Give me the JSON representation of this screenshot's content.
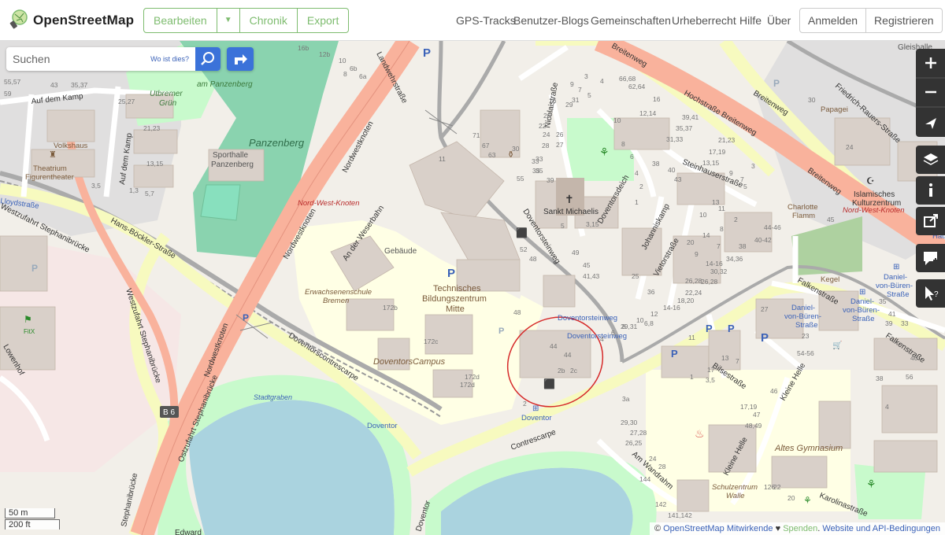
{
  "header": {
    "brand": "OpenStreetMap",
    "edit_label": "Bearbeiten",
    "history_label": "Chronik",
    "export_label": "Export",
    "nav": [
      "GPS-Tracks",
      "Benutzer-Blogs",
      "Gemeinschaften",
      "Urheberrecht",
      "Hilfe",
      "Über"
    ],
    "login_label": "Anmelden",
    "signup_label": "Registrieren"
  },
  "search": {
    "placeholder": "Suchen",
    "where_label": "Wo ist dies?"
  },
  "map_controls": [
    "zoom-in",
    "zoom-out",
    "locate",
    "layers",
    "info",
    "share",
    "note",
    "query"
  ],
  "scale": {
    "metric": "50 m",
    "imperial": "200 ft"
  },
  "attribution": {
    "prefix": "©",
    "contributors": "OpenStreetMap Mitwirkende",
    "heart": "♥",
    "donate": "Spenden",
    "terms": "Website und API-Bedingungen"
  },
  "map_labels": {
    "panzenberg": "Panzenberg",
    "am_panzenberg": "am Panzenberg",
    "utbremer": "Utbremer",
    "gruen": "Grün",
    "sporthalle": "Sporthalle",
    "sporthalle2": "Panzenberg",
    "auf_dem_kamp": "Auf dem Kamp",
    "auf_dem_kamp_v": "Auf dem Kamp",
    "volkshaus": "Volkshaus",
    "theatrium": "Theatrium",
    "figurentheater": "Figurentheater",
    "lloydstrasse": "Lloydstraße",
    "westzufahrt": "Westzufahrt Stephanibrücke",
    "westzufahrt2": "Westzufahrt Stephanibrücke",
    "hans_boeckler": "Hans-Böckler-Straße",
    "lowenhof": "Lowenhof",
    "fitx": "FitX",
    "nordwestknoten1": "Nordwestknoten",
    "nordwestknoten2": "Nordwestknoten",
    "nordwestknoten3": "Nordwestknoten",
    "nordwestknoten4": "Nordwestknoten",
    "nord_west_knoten": "Nord-West-Knoten",
    "nord_west_knoten2": "Nord-West-Knoten",
    "landwehrstrasse": "Landwehrstraße",
    "an_der_weserbahn": "An der Weserbahn",
    "gebaeude": "Gebäude",
    "erwachsenenschule": "Erwachsenenschule",
    "bremen": "Bremen",
    "tbz1": "Technisches",
    "tbz2": "Bildungszentrum",
    "tbz3": "Mitte",
    "doventors_campus": "DoventorsCampus",
    "doventorscontrescarpe": "Doventorscontrescarpe",
    "ostzufahrt": "Ostzufahrt Stephanibrücke",
    "stephanibruecke": "Stephanibrücke",
    "stadtgraben": "Stadtgraben",
    "b6": "B 6",
    "doventor": "Doventor",
    "doventor_stop": "Doventor",
    "doventor_road": "Doventor",
    "contrescarpe": "Contrescarpe",
    "doventorsteinweg": "Doventorsteinweg",
    "doventorsteinweg2": "Doventorsteinweg",
    "doventorsteinweg3": "Doventorsteinweg",
    "nicolaistrasse": "Nicolaistraße",
    "sankt_michaelis": "Sankt Michaelis",
    "doventorsdeich": "Doventorsdeich",
    "johanniskamp": "Johanniskamp",
    "steinhauserstrasse": "Steinhauserstraße",
    "vietorstrasse": "Vietorstraße",
    "breitenweg1": "Breitenweg",
    "breitenweg2": "Breitenweg",
    "breitenweg3": "Breitenweg",
    "hochstrasse": "Hochstraße Breitenweg",
    "friedrich": "Friedrich-Rauers-Straße",
    "papageno": "Papagei",
    "islamisches": "Islamisches",
    "kulturzentrum": "Kulturzentrum",
    "charlotte": "Charlotte",
    "flamm": "Flamm",
    "kegel": "Kegel",
    "falkenstrasse": "Falkenstraße",
    "falkenstrasse2": "Falkenstraße",
    "daniel1": "Daniel-",
    "daniel2": "von-Büren-",
    "daniel3": "Straße",
    "daniel4": "Daniel-",
    "daniel5": "von-Büren-",
    "daniel6": "Straße",
    "daniel7": "Daniel-",
    "daniel8": "von-Büren-",
    "daniel9": "Straße",
    "bilsestrasse": "Bilsestraße",
    "kleine_helle": "Kleine Helle",
    "kleine_helle2": "Kleine Helle",
    "altes_gymnasium": "Altes Gymnasium",
    "am_wandrahm": "Am Wandrahm",
    "schulzentrum": "Schulzentrum",
    "walle": "Walle",
    "karolinastrasse": "Karolinastraße",
    "gleishalle": "Gleishalle",
    "edward": "Edward",
    "hau": "Hau",
    "hausnr": [
      "16b",
      "12b",
      "10",
      "8",
      "6b",
      "6a",
      "55,57",
      "43",
      "35,37",
      "59",
      "25,27",
      "21,23",
      "13,15",
      "3,5",
      "1,3",
      "5,7",
      "16",
      "20",
      "22",
      "24",
      "26",
      "28",
      "30",
      "33",
      "35",
      "39",
      "27",
      "29",
      "31",
      "71",
      "67",
      "63",
      "55",
      "33",
      "35",
      "11",
      "9",
      "7",
      "5",
      "4",
      "3",
      "66,68",
      "62,64",
      "12,14",
      "16",
      "10",
      "8",
      "6",
      "4",
      "2",
      "1",
      "38",
      "40",
      "43",
      "39,41",
      "35,37",
      "31,33",
      "21,23",
      "17,19",
      "13,15",
      "9",
      "7",
      "5",
      "3",
      "49",
      "45",
      "41,43",
      "25",
      "36",
      "13",
      "11",
      "10",
      "14",
      "9",
      "8",
      "7",
      "2",
      "3,15",
      "5",
      "52",
      "48",
      "172b",
      "172c",
      "172d",
      "172d",
      "48",
      "44",
      "2b",
      "2c",
      "44",
      "2",
      "20",
      "18,20",
      "22,24",
      "26,28",
      "30,32",
      "34,36",
      "38",
      "40-42",
      "44-46",
      "14-16",
      "12",
      "10",
      "8",
      "6",
      "4",
      "29,31",
      "6,8",
      "26,28",
      "14-16",
      "24",
      "30",
      "45",
      "35",
      "41",
      "39",
      "33",
      "11",
      "27",
      "17",
      "13",
      "7",
      "3,5",
      "1",
      "17,19",
      "47",
      "48,49",
      "46",
      "3a",
      "29,30",
      "27,28",
      "26,25",
      "24",
      "28",
      "144",
      "142",
      "141,142",
      "126",
      "20",
      "22",
      "23",
      "54-56",
      "56",
      "40",
      "38",
      "4",
      "2"
    ]
  }
}
